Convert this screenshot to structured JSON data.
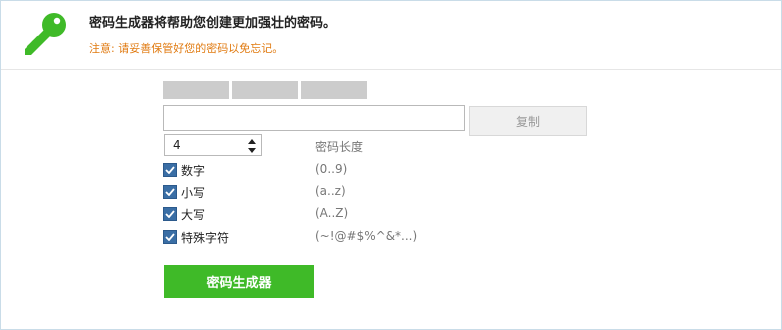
{
  "header": {
    "title": "密码生成器将帮助您创建更加强壮的密码。",
    "warning": "注意: 请妥善保管好您的密码以免忘记。",
    "icon": "key-icon",
    "icon_color": "#3fba28",
    "warning_color": "#e07a10"
  },
  "strength_meter": {
    "segments": 3,
    "filled": 0
  },
  "password": {
    "value": "",
    "placeholder": ""
  },
  "copy_button": {
    "label": "复制"
  },
  "length": {
    "value": "4",
    "label": "密码长度"
  },
  "options": [
    {
      "label": "数字",
      "hint": "(0..9)",
      "checked": true
    },
    {
      "label": "小写",
      "hint": "(a..z)",
      "checked": true
    },
    {
      "label": "大写",
      "hint": "(A..Z)",
      "checked": true
    },
    {
      "label": "特殊字符",
      "hint": "(~!@#$%^&*...)",
      "checked": true
    }
  ],
  "generate_button": {
    "label": "密码生成器",
    "color": "#3fba28"
  }
}
